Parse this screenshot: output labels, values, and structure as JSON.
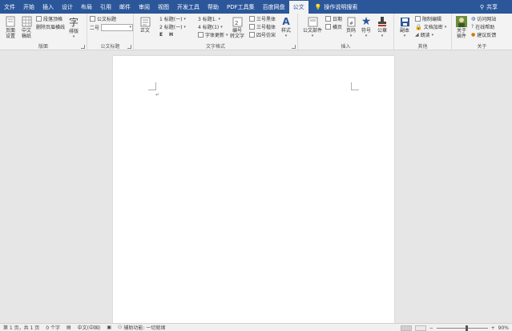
{
  "tabs": [
    "文件",
    "开始",
    "插入",
    "设计",
    "布局",
    "引用",
    "邮件",
    "审阅",
    "视图",
    "开发工具",
    "帮助",
    "PDF工具集",
    "百度网盘",
    "公文"
  ],
  "active_tab_index": 13,
  "search_label": "操作说明搜索",
  "share_label": "共享",
  "ribbon": {
    "page_group": {
      "label": "版面",
      "page_setup": "页面\n设置",
      "chinese_grid": "中文\n稿纸",
      "para_top_bottom": "段落顶格",
      "remove_header_line": "删除页眉横线",
      "layout": "排版"
    },
    "doc_title_group": {
      "label": "公文标题",
      "title_btn": "公文标题",
      "size_label": "二号",
      "size_value": ""
    },
    "text_format_group": {
      "label": "文字格式",
      "body": "正文",
      "h1": "1 标题(一)",
      "h2": "2 标题(一)",
      "e": "E",
      "h": "H",
      "h3": "3 标题1.",
      "h4": "4 标题(1)",
      "font_update": "字体更新",
      "numbering": "编号\n转文字",
      "font1": "三号黑体",
      "font2": "三号楷体",
      "font3": "四号仿宋",
      "style": "样式"
    },
    "insert_group": {
      "label": "插入",
      "doc_parts": "公文部件",
      "date": "日期",
      "horizontal": "横页",
      "page_num": "页码",
      "symbol": "符号",
      "seal": "公章"
    },
    "other_group": {
      "label": "其他",
      "copy": "副本",
      "restrict_edit": "限制编辑",
      "doc_encrypt": "文档加密",
      "read": "朗读"
    },
    "about_group": {
      "label": "关于",
      "about_plugin": "关于\n插件",
      "visit_site": "访问网站",
      "online_help": "在线帮助",
      "feedback": "建议反馈"
    }
  },
  "status": {
    "page": "第 1 页，共 1 页",
    "words": "0 个字",
    "lang": "中文(中国)",
    "accessibility": "辅助功能: 一切就绪",
    "zoom": "90%"
  },
  "colors": {
    "accent": "#2b579a"
  }
}
